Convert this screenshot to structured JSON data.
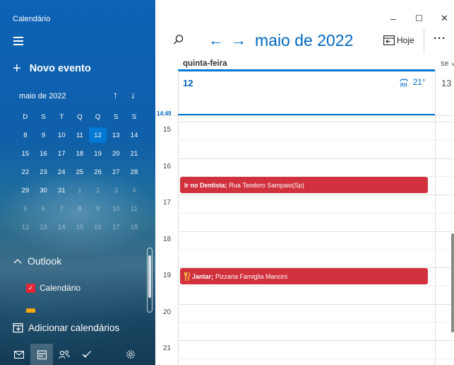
{
  "app": {
    "title": "Calendário"
  },
  "sidebar": {
    "new_event": "Novo evento",
    "mini_calendar": {
      "month_label": "maio de 2022",
      "weekdays": [
        "D",
        "S",
        "T",
        "Q",
        "Q",
        "S",
        "S"
      ],
      "weeks": [
        [
          {
            "d": "8"
          },
          {
            "d": "9"
          },
          {
            "d": "10"
          },
          {
            "d": "11"
          },
          {
            "d": "12",
            "today": true
          },
          {
            "d": "13"
          },
          {
            "d": "14"
          }
        ],
        [
          {
            "d": "15"
          },
          {
            "d": "16"
          },
          {
            "d": "17"
          },
          {
            "d": "18"
          },
          {
            "d": "19"
          },
          {
            "d": "20"
          },
          {
            "d": "21"
          }
        ],
        [
          {
            "d": "22"
          },
          {
            "d": "23"
          },
          {
            "d": "24"
          },
          {
            "d": "25"
          },
          {
            "d": "26"
          },
          {
            "d": "27"
          },
          {
            "d": "28"
          }
        ],
        [
          {
            "d": "29"
          },
          {
            "d": "30"
          },
          {
            "d": "31"
          },
          {
            "d": "1",
            "other": true
          },
          {
            "d": "2",
            "other": true
          },
          {
            "d": "3",
            "other": true
          },
          {
            "d": "4",
            "other": true
          }
        ],
        [
          {
            "d": "5",
            "other": true
          },
          {
            "d": "6",
            "other": true
          },
          {
            "d": "7",
            "other": true
          },
          {
            "d": "8",
            "other": true
          },
          {
            "d": "9",
            "other": true
          },
          {
            "d": "10",
            "other": true
          },
          {
            "d": "11",
            "other": true
          }
        ],
        [
          {
            "d": "12",
            "other": true
          },
          {
            "d": "13",
            "other": true
          },
          {
            "d": "14",
            "other": true
          },
          {
            "d": "15",
            "other": true
          },
          {
            "d": "16",
            "other": true
          },
          {
            "d": "17",
            "other": true
          },
          {
            "d": "18",
            "other": true
          }
        ]
      ]
    },
    "account": "Outlook",
    "calendars": [
      {
        "name": "Calendário",
        "checked": true,
        "color": "#e81123"
      }
    ],
    "add_calendars": "Adicionar calendários",
    "bottom_icons": [
      "mail-icon",
      "calendar-icon",
      "people-icon",
      "todo-icon",
      "settings-icon"
    ]
  },
  "toolbar": {
    "month_title": "maio de 2022",
    "today_label": "Hoje",
    "more_label": "···"
  },
  "window_controls": {
    "minimize": "–",
    "maximize": "☐",
    "close": "✕"
  },
  "day_view": {
    "day_name": "quinta-feira",
    "day_number": "12",
    "next_day_name": "se",
    "next_day_number": "13",
    "weather_temp": "21°",
    "current_time": "14:49",
    "hours": [
      "15",
      "16",
      "17",
      "18",
      "19",
      "20",
      "21"
    ]
  },
  "events": [
    {
      "title": "Ir no Dentista;",
      "location": "Rua Teodoro Sampaio(Sp)",
      "color": "#d1313d",
      "has_icon": false
    },
    {
      "title": "Jantar;",
      "location": "Pizzaria Famiglia Mancini",
      "color": "#d1313d",
      "has_icon": true
    }
  ]
}
